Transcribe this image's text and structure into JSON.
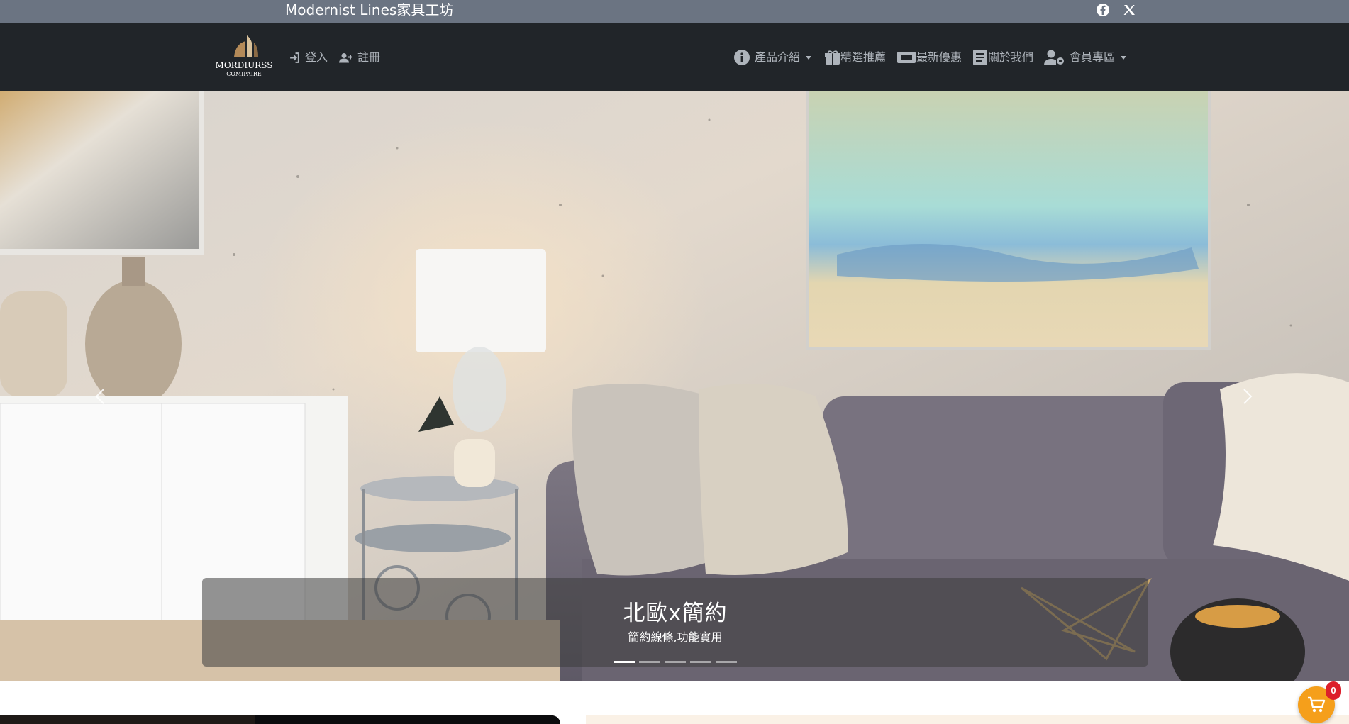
{
  "topbar": {
    "site_title": "Modernist Lines家具工坊",
    "social": [
      {
        "icon": "facebook-icon"
      },
      {
        "icon": "x-twitter-icon"
      }
    ]
  },
  "navbar": {
    "logo": {
      "line1": "MORDIURSS",
      "line2": "COMIPAIRE"
    },
    "auth": {
      "login": {
        "label": "登入",
        "icon": "login-icon"
      },
      "register": {
        "label": "註冊",
        "icon": "user-plus-icon"
      }
    },
    "menu": [
      {
        "label": "產品介紹",
        "icon": "info-circle-icon",
        "dropdown": true
      },
      {
        "label": "精選推薦",
        "icon": "gift-box-icon",
        "dropdown": false
      },
      {
        "label": "最新優惠",
        "icon": "ticket-icon",
        "dropdown": false
      },
      {
        "label": "關於我們",
        "icon": "document-icon",
        "dropdown": false
      },
      {
        "label": "會員專區",
        "icon": "user-gear-icon",
        "dropdown": true
      }
    ]
  },
  "carousel": {
    "caption_title": "北歐x簡約",
    "caption_subtitle": "簡約線條,功能實用",
    "slide_count": 5,
    "active_index": 0,
    "prev_icon": "chevron-left-icon",
    "next_icon": "chevron-right-icon"
  },
  "cart": {
    "count": "0",
    "icon": "shopping-cart-icon",
    "color": "#f59f1b",
    "badge_color": "#dc1f2b"
  },
  "colors": {
    "topbar": "#6b7482",
    "navbar": "#212529",
    "nav_text": "#aeb4bb"
  }
}
